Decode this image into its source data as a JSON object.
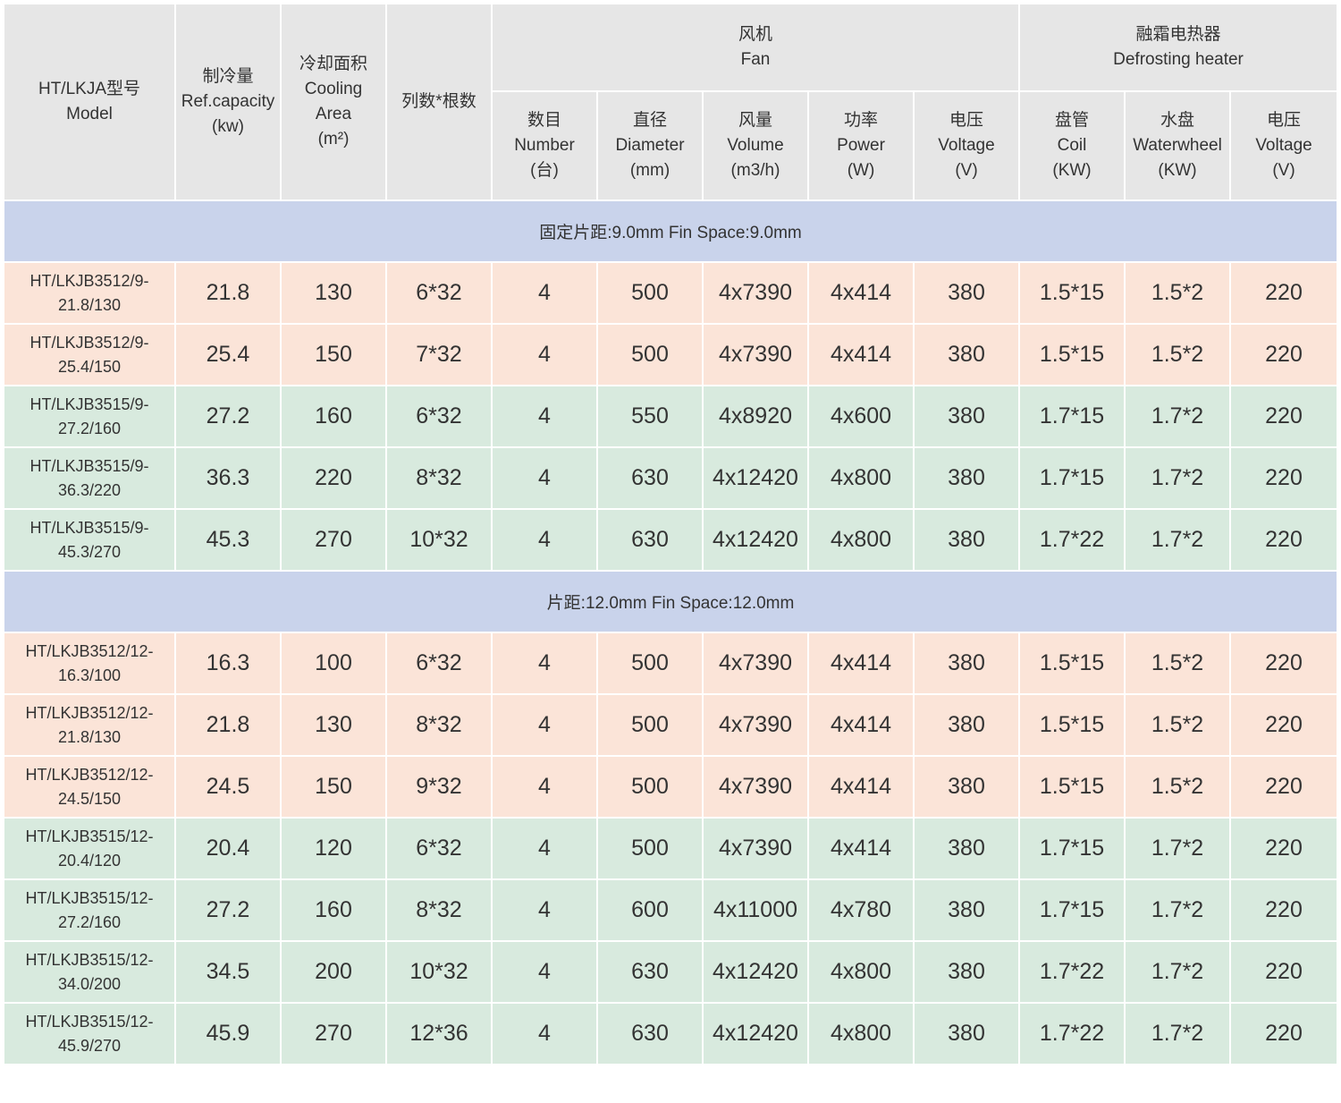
{
  "table": {
    "header": {
      "model": [
        "HT/LKJA型号",
        "Model"
      ],
      "capacity": [
        "制冷量",
        "Ref.capacity",
        "(kw)"
      ],
      "area": [
        "冷却面积",
        "Cooling",
        "Area",
        "(m²)"
      ],
      "rows_tubes": [
        "列数*根数"
      ],
      "fan": [
        "风机",
        "Fan"
      ],
      "defrost": [
        "融霜电热器",
        "Defrosting heater"
      ],
      "fan_cols": [
        [
          "数目",
          "Number",
          "(台)"
        ],
        [
          "直径",
          "Diameter",
          "(mm)"
        ],
        [
          "风量",
          "Volume",
          "(m3/h)"
        ],
        [
          "功率",
          "Power",
          "(W)"
        ],
        [
          "电压",
          "Voltage",
          "(V)"
        ]
      ],
      "defrost_cols": [
        [
          "盘管",
          "Coil",
          "(KW)"
        ],
        [
          "水盘",
          "Waterwheel",
          "(KW)"
        ],
        [
          "电压",
          "Voltage",
          "(V)"
        ]
      ]
    },
    "sections": [
      {
        "title": "固定片距:9.0mm Fin Space:9.0mm",
        "rows": [
          {
            "color": "peach",
            "model": [
              "HT/LKJB3512/9-",
              "21.8/130"
            ],
            "cells": [
              "21.8",
              "130",
              "6*32",
              "4",
              "500",
              "4x7390",
              "4x414",
              "380",
              "1.5*15",
              "1.5*2",
              "220"
            ]
          },
          {
            "color": "peach",
            "model": [
              "HT/LKJB3512/9-",
              "25.4/150"
            ],
            "cells": [
              "25.4",
              "150",
              "7*32",
              "4",
              "500",
              "4x7390",
              "4x414",
              "380",
              "1.5*15",
              "1.5*2",
              "220"
            ]
          },
          {
            "color": "green",
            "model": [
              "HT/LKJB3515/9-",
              "27.2/160"
            ],
            "cells": [
              "27.2",
              "160",
              "6*32",
              "4",
              "550",
              "4x8920",
              "4x600",
              "380",
              "1.7*15",
              "1.7*2",
              "220"
            ]
          },
          {
            "color": "green",
            "model": [
              "HT/LKJB3515/9-",
              "36.3/220"
            ],
            "cells": [
              "36.3",
              "220",
              "8*32",
              "4",
              "630",
              "4x12420",
              "4x800",
              "380",
              "1.7*15",
              "1.7*2",
              "220"
            ]
          },
          {
            "color": "green",
            "model": [
              "HT/LKJB3515/9-",
              "45.3/270"
            ],
            "cells": [
              "45.3",
              "270",
              "10*32",
              "4",
              "630",
              "4x12420",
              "4x800",
              "380",
              "1.7*22",
              "1.7*2",
              "220"
            ]
          }
        ]
      },
      {
        "title": "片距:12.0mm Fin Space:12.0mm",
        "rows": [
          {
            "color": "peach",
            "model": [
              "HT/LKJB3512/12-",
              "16.3/100"
            ],
            "cells": [
              "16.3",
              "100",
              "6*32",
              "4",
              "500",
              "4x7390",
              "4x414",
              "380",
              "1.5*15",
              "1.5*2",
              "220"
            ]
          },
          {
            "color": "peach",
            "model": [
              "HT/LKJB3512/12-",
              "21.8/130"
            ],
            "cells": [
              "21.8",
              "130",
              "8*32",
              "4",
              "500",
              "4x7390",
              "4x414",
              "380",
              "1.5*15",
              "1.5*2",
              "220"
            ]
          },
          {
            "color": "peach",
            "model": [
              "HT/LKJB3512/12-",
              "24.5/150"
            ],
            "cells": [
              "24.5",
              "150",
              "9*32",
              "4",
              "500",
              "4x7390",
              "4x414",
              "380",
              "1.5*15",
              "1.5*2",
              "220"
            ]
          },
          {
            "color": "green",
            "model": [
              "HT/LKJB3515/12-",
              "20.4/120"
            ],
            "cells": [
              "20.4",
              "120",
              "6*32",
              "4",
              "500",
              "4x7390",
              "4x414",
              "380",
              "1.7*15",
              "1.7*2",
              "220"
            ]
          },
          {
            "color": "green",
            "model": [
              "HT/LKJB3515/12-",
              "27.2/160"
            ],
            "cells": [
              "27.2",
              "160",
              "8*32",
              "4",
              "600",
              "4x11000",
              "4x780",
              "380",
              "1.7*15",
              "1.7*2",
              "220"
            ]
          },
          {
            "color": "green",
            "model": [
              "HT/LKJB3515/12-",
              "34.0/200"
            ],
            "cells": [
              "34.5",
              "200",
              "10*32",
              "4",
              "630",
              "4x12420",
              "4x800",
              "380",
              "1.7*22",
              "1.7*2",
              "220"
            ]
          },
          {
            "color": "green",
            "model": [
              "HT/LKJB3515/12-",
              "45.9/270"
            ],
            "cells": [
              "45.9",
              "270",
              "12*36",
              "4",
              "630",
              "4x12420",
              "4x800",
              "380",
              "1.7*22",
              "1.7*2",
              "220"
            ]
          }
        ]
      }
    ]
  },
  "colors": {
    "header_bg": "#e6e6e6",
    "section_bg": "#c9d3eb",
    "peach_row": "#fbe4d8",
    "green_row": "#d8eade",
    "text": "#333333"
  }
}
